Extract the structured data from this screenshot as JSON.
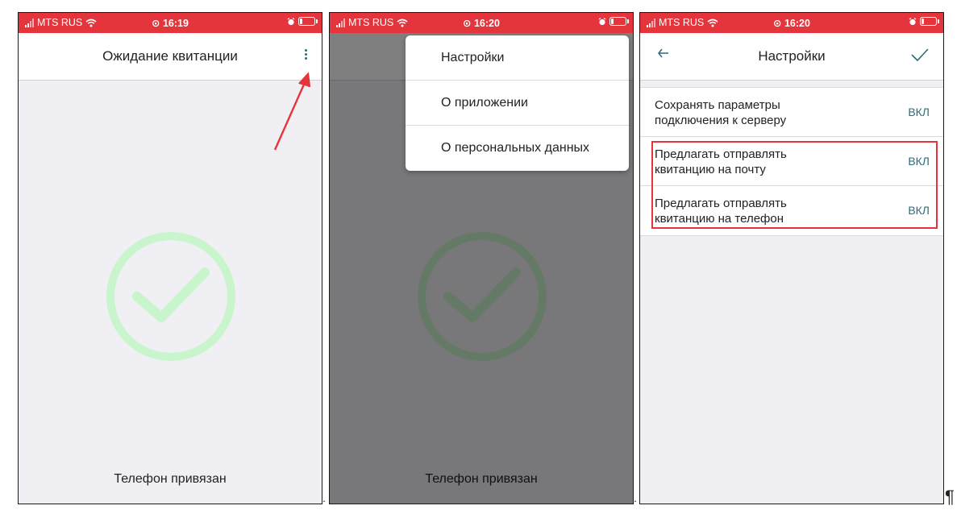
{
  "status": {
    "carrier": "MTS RUS",
    "time1": "16:19",
    "time2": "16:20",
    "time3": "16:20"
  },
  "screen1": {
    "title": "Ожидание квитанции",
    "footer": "Телефон привязан"
  },
  "screen2": {
    "menu": [
      "Настройки",
      "О приложении",
      "О персональных данных"
    ],
    "footer": "Телефон привязан"
  },
  "screen3": {
    "title": "Настройки",
    "settings": [
      {
        "label": "Сохранять параметры подключения к серверу",
        "value": "ВКЛ"
      },
      {
        "label": "Предлагать отправлять квитанцию на почту",
        "value": "ВКЛ"
      },
      {
        "label": "Предлагать отправлять квитанцию на телефон",
        "value": "ВКЛ"
      }
    ]
  },
  "separators": {
    "dot": ".",
    "pilcrow": "¶"
  },
  "colors": {
    "status_bar": "#e4353c",
    "accent": "#2f6b78",
    "check_light": "#c9f5cc",
    "highlight": "#e4353c"
  },
  "icons": [
    "wifi-icon",
    "alarm-icon",
    "battery-icon",
    "kebab-menu-icon",
    "check-circle-icon",
    "back-arrow-icon",
    "checkmark-icon",
    "red-arrow-icon"
  ]
}
